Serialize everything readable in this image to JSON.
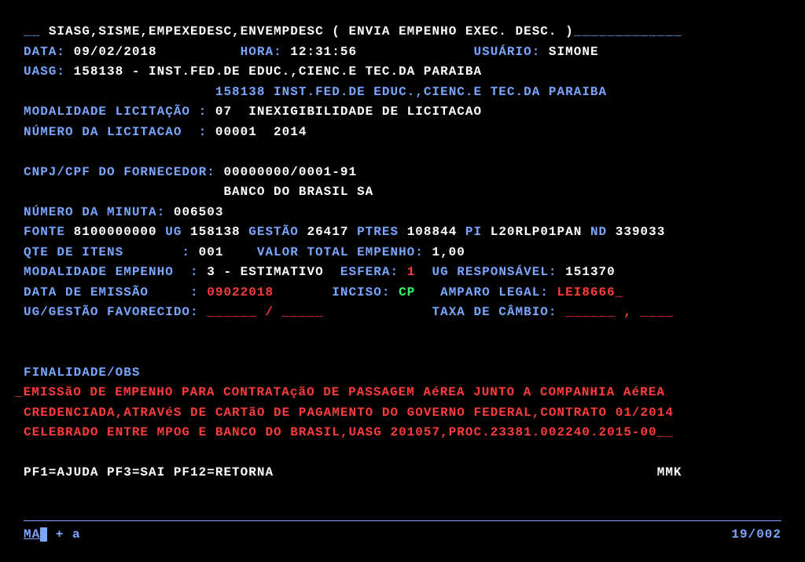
{
  "header": {
    "prefix": "__ ",
    "title": "SIASG,SISME,EMPEXEDESC,ENVEMPDESC ( ENVIA EMPENHO EXEC. DESC. )",
    "suffix": "_____________"
  },
  "line2": {
    "data_lbl": "DATA:",
    "data_val": " 09/02/2018",
    "gap1": "          ",
    "hora_lbl": "HORA:",
    "hora_val": " 12:31:56",
    "gap2": "              ",
    "user_lbl": "USUÁRIO:",
    "user_val": " SIMONE"
  },
  "line3": {
    "uasg_lbl": "UASG:",
    "uasg_code": " 158138 - ",
    "uasg_name": "INST.FED.DE EDUC.,CIENC.E TEC.DA PARAIBA"
  },
  "line4": {
    "pad": "                       ",
    "text": "158138 INST.FED.DE EDUC.,CIENC.E TEC.DA PARAIBA"
  },
  "line5": {
    "lbl": "MODALIDADE LICITAÇÃO :",
    "val": " 07  INEXIGIBILIDADE DE LICITACAO"
  },
  "line6": {
    "lbl_a": "NÚMERO",
    "lbl_b": " DA LICITACAO  :",
    "val": " 00001  2014"
  },
  "line8": {
    "lbl": "CNPJ/CPF DO FORNECEDOR:",
    "val": " 00000000/0001-91"
  },
  "line9": {
    "pad": "                        ",
    "val": "BANCO DO BRASIL SA"
  },
  "line10": {
    "lbl": "NÚMERO DA MINUTA:",
    "val": " 006503"
  },
  "line11": {
    "fonte_lbl": "FONTE",
    "fonte_val": " 8100000000 ",
    "ug_lbl": "UG",
    "ug_val": " 158138 ",
    "gestao_lbl": "GESTÃO",
    "gestao_val": " 26417 ",
    "ptres_lbl": "PTRES",
    "ptres_val": " 108844 ",
    "pi_lbl": "PI",
    "pi_val": " L20RLP01PAN ",
    "nd_lbl": "ND",
    "nd_val": " 339033"
  },
  "line12": {
    "qte_lbl": "QTE DE ITENS       :",
    "qte_val": " 001    ",
    "tot_lbl": "VALOR TOTAL EMPENHO:",
    "tot_val": " 1,00"
  },
  "line13": {
    "mod_lbl": "MODALIDADE EMPENHO  :",
    "mod_val": " 3 - ESTIMATIVO  ",
    "esf_lbl": "ESFERA:",
    "esf_val": " 1  ",
    "ugr_lbl": "UG RESPONSÁVEL:",
    "ugr_val": " 151370"
  },
  "line14": {
    "de_lbl": "DATA DE EMISSÃO     :",
    "de_val": " 09022018       ",
    "inc_lbl": "INCISO:",
    "inc_val": " CP   ",
    "amp_lbl": "AMPARO LEGAL:",
    "amp_val": " LEI8666_"
  },
  "line15": {
    "ugg_lbl": "UG/GESTÃO FAVORECIDO:",
    "ugg_val": " ______ / _____             ",
    "tax_lbl": "TAXA DE CÂMBIO:",
    "tax_val": " ______ , ____"
  },
  "line18": {
    "lbl": "FINALIDADE/OBS"
  },
  "obs_pre": "_",
  "obs1": "EMISSãO DE EMPENHO PARA CONTRATAçãO DE PASSAGEM AéREA JUNTO A COMPANHIA AéREA",
  "obs2": "CREDENCIADA,ATRAVéS DE CARTãO DE PAGAMENTO DO GOVERNO FEDERAL,CONTRATO 01/2014",
  "obs3": "CELEBRADO ENTRE MPOG E BANCO DO BRASIL,UASG 201057,PROC.23381.002240.2015-00__",
  "fkeys": {
    "text": "PF1=AJUDA PF3=SAI PF12=RETORNA",
    "pad": "                                              ",
    "tag": "MMK"
  },
  "status": {
    "left_a": "MA",
    "left_b": " + ",
    "left_c": "a",
    "right": "19/002"
  }
}
